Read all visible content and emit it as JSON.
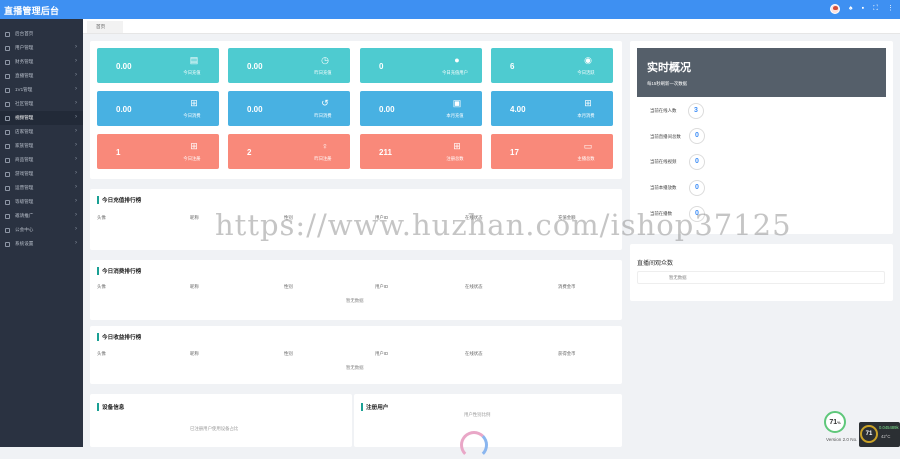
{
  "app": {
    "title": "直播管理后台"
  },
  "tab": {
    "label": "首页"
  },
  "sidebar": {
    "items": [
      {
        "label": "后台首页"
      },
      {
        "label": "用户管理"
      },
      {
        "label": "财务管理"
      },
      {
        "label": "直播管理"
      },
      {
        "label": "1V1管理"
      },
      {
        "label": "社区管理"
      },
      {
        "label": "视频管理"
      },
      {
        "label": "店家管理"
      },
      {
        "label": "家族管理"
      },
      {
        "label": "商品管理"
      },
      {
        "label": "游戏管理"
      },
      {
        "label": "运营管理"
      },
      {
        "label": "等级管理"
      },
      {
        "label": "邀请推广"
      },
      {
        "label": "公会中心"
      },
      {
        "label": "系统设置"
      }
    ]
  },
  "stats": [
    {
      "value": "0.00",
      "label": "今日充值",
      "icon": "file-icon",
      "color": "#4ecbd0"
    },
    {
      "value": "0.00",
      "label": "昨日充值",
      "icon": "clock-icon",
      "color": "#4ecbd0"
    },
    {
      "value": "0",
      "label": "今日充值用户",
      "icon": "user-icon",
      "color": "#4ecbd0"
    },
    {
      "value": "6",
      "label": "今日活跃",
      "icon": "user-circle-icon",
      "color": "#4ecbd0"
    },
    {
      "value": "0.00",
      "label": "今日消费",
      "icon": "cart-icon",
      "color": "#48b1e2"
    },
    {
      "value": "0.00",
      "label": "昨日消费",
      "icon": "history-icon",
      "color": "#48b1e2"
    },
    {
      "value": "0.00",
      "label": "本月充值",
      "icon": "badge-icon",
      "color": "#48b1e2"
    },
    {
      "value": "4.00",
      "label": "本月消费",
      "icon": "cart-icon",
      "color": "#48b1e2"
    },
    {
      "value": "1",
      "label": "今日注册",
      "icon": "cart-icon",
      "color": "#f9897a"
    },
    {
      "value": "2",
      "label": "昨日注册",
      "icon": "person-icon",
      "color": "#f9897a"
    },
    {
      "value": "211",
      "label": "注册总数",
      "icon": "cart-icon",
      "color": "#f9897a"
    },
    {
      "value": "17",
      "label": "主播总数",
      "icon": "id-card-icon",
      "color": "#f9897a"
    }
  ],
  "rank_recharge": {
    "title": "今日充值排行榜",
    "headers": [
      "头像",
      "昵称",
      "性别",
      "用户ID",
      "在线状态",
      "充值金额"
    ]
  },
  "rank_consume": {
    "title": "今日消费排行榜",
    "headers": [
      "头像",
      "昵称",
      "性别",
      "用户ID",
      "在线状态",
      "消费金币"
    ],
    "empty": "暂无数据"
  },
  "rank_income": {
    "title": "今日收益排行榜",
    "headers": [
      "头像",
      "昵称",
      "性别",
      "用户ID",
      "在线状态",
      "获得金币"
    ],
    "empty": "暂无数据"
  },
  "device": {
    "title": "设备信息",
    "note": "已注册用户使用设备占比"
  },
  "register": {
    "title": "注册用户",
    "note": "用户性别比例"
  },
  "realtime": {
    "title": "实时概况",
    "subtitle": "每15秒刷新一次数据",
    "rows": [
      {
        "label": "当前在线人数",
        "value": "3"
      },
      {
        "label": "当前直播间总数",
        "value": "0"
      },
      {
        "label": "当前在线视频",
        "value": "0"
      },
      {
        "label": "当前本播放数",
        "value": "0"
      },
      {
        "label": "当前在播数",
        "value": "0"
      }
    ]
  },
  "viewers": {
    "title": "直播间观众数",
    "empty": "暂无数据"
  },
  "footer": {
    "version": "Version 2.0 No.",
    "gauge1": "71",
    "gauge1_unit": "%",
    "gauge2": "71",
    "net": "0.045489k",
    "temp": "42°C"
  },
  "watermark": "https://www.huzhan.com/ishop37125"
}
